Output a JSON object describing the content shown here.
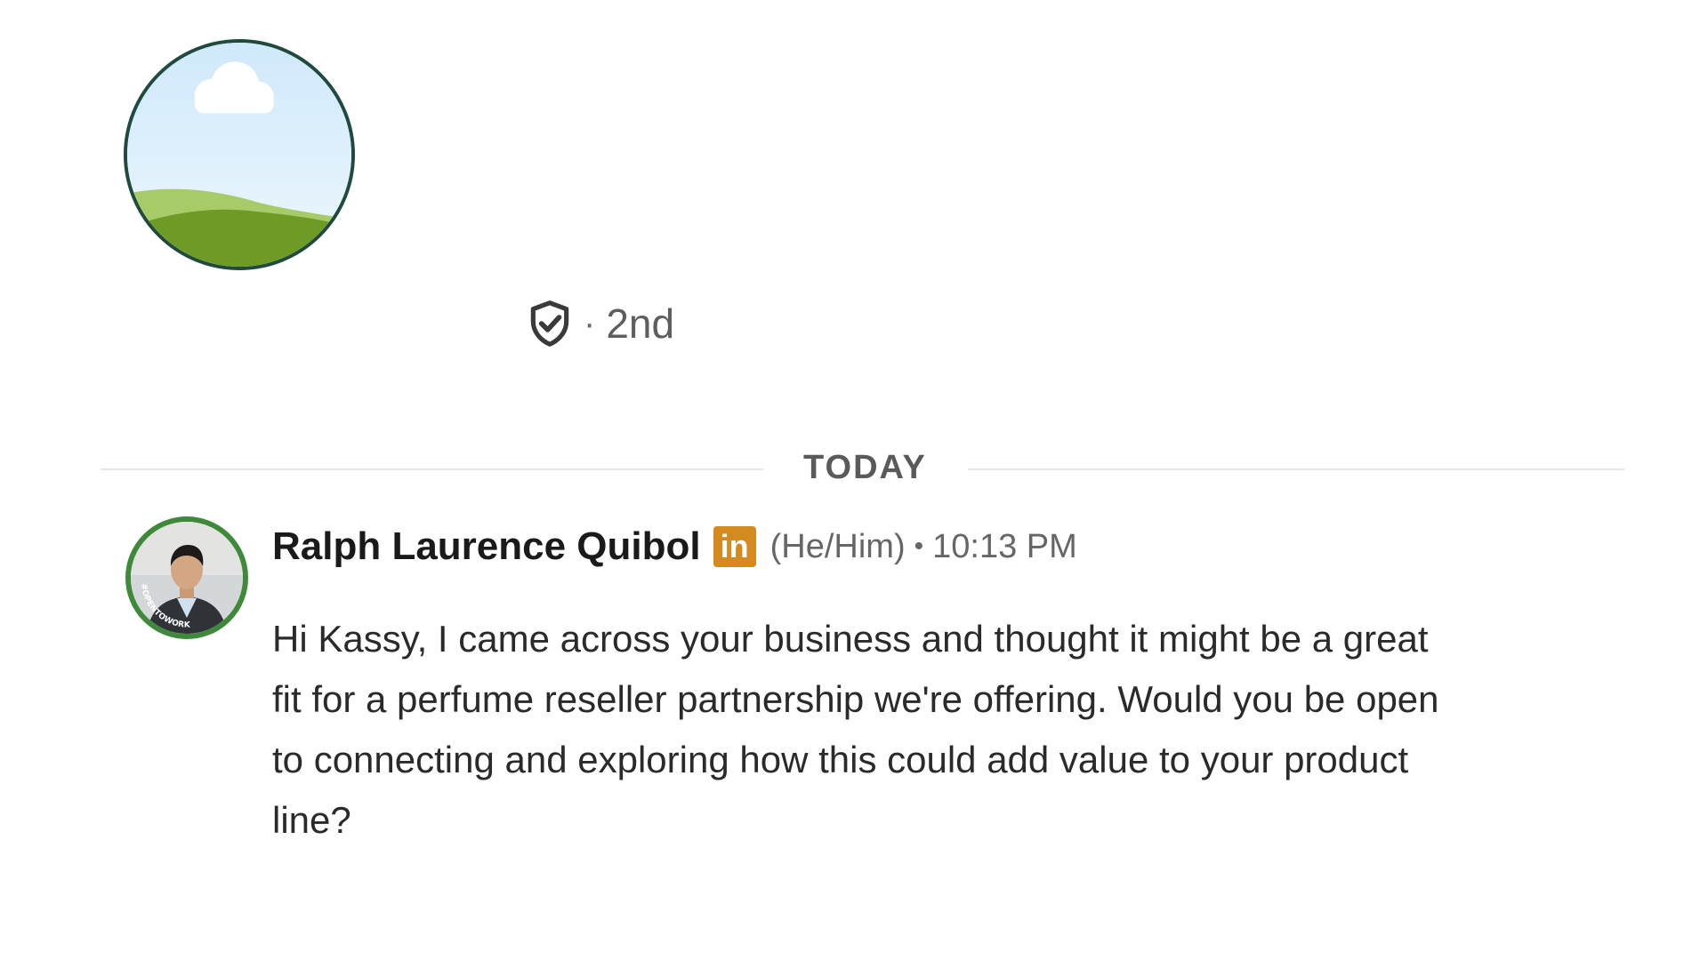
{
  "profile": {
    "avatar_icon": "default-landscape-avatar-icon",
    "verification_icon": "shield-check-icon",
    "degree_separator": "·",
    "degree": "2nd"
  },
  "divider": {
    "label": "TODAY"
  },
  "message": {
    "sender_name": "Ralph Laurence Quibol",
    "badge_text": "in",
    "badge_color": "#d58a1f",
    "pronouns": "(He/Him)",
    "separator": "•",
    "time": "10:13 PM",
    "avatar_ring_text": "#OPENTOWORK",
    "avatar_ring_color": "#3f8a3a",
    "body": "Hi Kassy, I came across your business and thought it might be a great fit for a perfume reseller partnership we're offering. Would you be open to connecting and exploring how this could add value to your product line?"
  }
}
